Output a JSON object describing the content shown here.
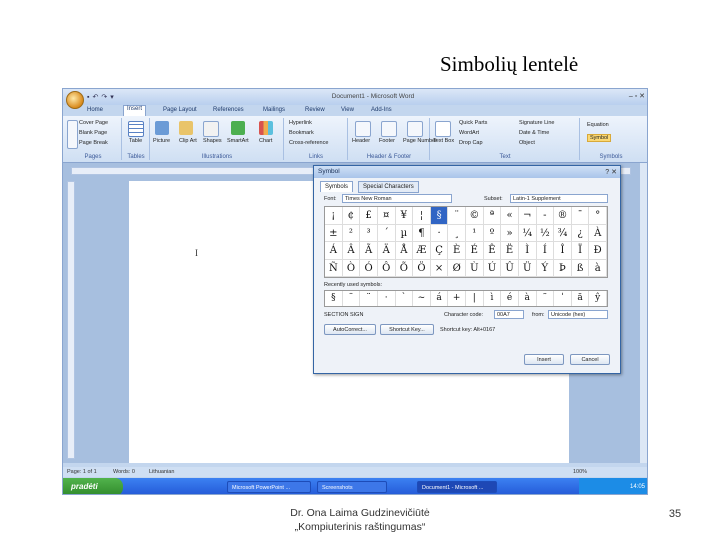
{
  "slide": {
    "title": "Simbolių lentelė",
    "author": "Dr. Ona Laima Gudzinevičiūtė",
    "course": "„Kompiuterinis raštingumas“",
    "page_number": "35"
  },
  "word": {
    "window_title": "Document1 - Microsoft Word",
    "tabs": [
      "Home",
      "Insert",
      "Page Layout",
      "References",
      "Mailings",
      "Review",
      "View",
      "Add-Ins"
    ],
    "active_tab": "Insert",
    "groups": {
      "pages": {
        "label": "Pages",
        "items": [
          "Cover Page",
          "Blank Page",
          "Page Break"
        ]
      },
      "tables": {
        "label": "Tables",
        "items": [
          "Table"
        ]
      },
      "illustrations": {
        "label": "Illustrations",
        "items": [
          "Picture",
          "Clip Art",
          "Shapes",
          "SmartArt",
          "Chart"
        ]
      },
      "links": {
        "label": "Links",
        "items": [
          "Hyperlink",
          "Bookmark",
          "Cross-reference"
        ]
      },
      "header_footer": {
        "label": "Header & Footer",
        "items": [
          "Header",
          "Footer",
          "Page Number"
        ]
      },
      "text": {
        "label": "Text",
        "items": [
          "Text Box",
          "Quick Parts",
          "WordArt",
          "Drop Cap",
          "Signature Line",
          "Date & Time",
          "Object"
        ]
      },
      "symbols": {
        "label": "Symbols",
        "items": [
          "Equation",
          "Symbol"
        ]
      }
    },
    "status": {
      "page": "Page: 1 of 1",
      "words": "Words: 0",
      "language": "Lithuanian"
    },
    "zoom": "100%",
    "taskbar": {
      "start": "pradėti",
      "tasks": [
        "Microsoft PowerPoint ...",
        "Screenshots",
        "Document1 - Microsoft ..."
      ],
      "clock": "14:05"
    }
  },
  "dialog": {
    "title": "Symbol",
    "tabs": [
      "Symbols",
      "Special Characters"
    ],
    "font_label": "Font:",
    "font_value": "Times New Roman",
    "subset_label": "Subset:",
    "subset_value": "Latin-1 Supplement",
    "symbols_rows": [
      [
        "¡",
        "¢",
        "£",
        "¤",
        "¥",
        "¦",
        "§",
        "¨",
        "©",
        "ª",
        "«",
        "¬",
        "-",
        "®",
        "¯",
        "°"
      ],
      [
        "±",
        "²",
        "³",
        "´",
        "µ",
        "¶",
        "·",
        "¸",
        "¹",
        "º",
        "»",
        "¼",
        "½",
        "¾",
        "¿",
        "À"
      ],
      [
        "Á",
        "Â",
        "Ã",
        "Ä",
        "Å",
        "Æ",
        "Ç",
        "È",
        "É",
        "Ê",
        "Ë",
        "Ì",
        "Í",
        "Î",
        "Ï",
        "Ð"
      ],
      [
        "Ñ",
        "Ò",
        "Ó",
        "Ô",
        "Õ",
        "Ö",
        "×",
        "Ø",
        "Ù",
        "Ú",
        "Û",
        "Ü",
        "Ý",
        "Þ",
        "ß",
        "à"
      ]
    ],
    "selected_symbol": "§",
    "recent_label": "Recently used symbols:",
    "recent_symbols": [
      "§",
      "¨",
      "¨",
      "·",
      "`",
      "~",
      "á",
      "+",
      "|",
      "ì",
      "é",
      "à",
      "˜",
      "ˈ",
      "ă",
      "ŷ"
    ],
    "char_name_label": "SECTION SIGN",
    "char_code_label": "Character code:",
    "char_code_value": "00A7",
    "from_label": "from:",
    "from_value": "Unicode (hex)",
    "autocorrect_button": "AutoCorrect...",
    "shortcut_key_button": "Shortcut Key...",
    "shortcut_text": "Shortcut key: Alt+0167",
    "insert_button": "Insert",
    "cancel_button": "Cancel"
  }
}
